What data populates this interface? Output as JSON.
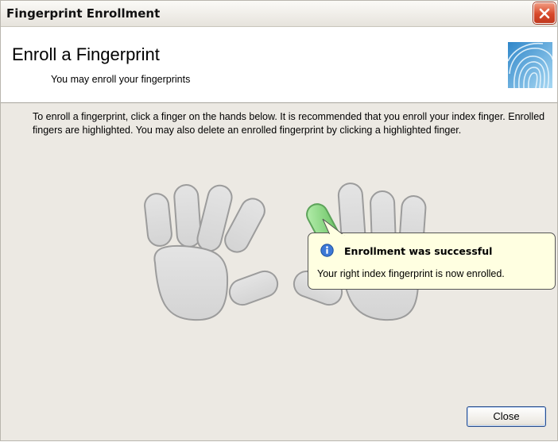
{
  "window": {
    "title": "Fingerprint Enrollment"
  },
  "header": {
    "title": "Enroll a Fingerprint",
    "subtitle": "You may enroll your fingerprints",
    "logo_icon": "fingerprint-icon"
  },
  "body": {
    "instructions": "To enroll a fingerprint, click a finger on the hands below. It is recommended that you enroll your index finger. Enrolled fingers are highlighted. You may also delete an enrolled fingerprint by clicking a highlighted finger."
  },
  "tooltip": {
    "icon": "info-icon",
    "title": "Enrollment was successful",
    "message": "Your right index fingerprint is now enrolled."
  },
  "hands": {
    "enrolled_finger": "right-index",
    "enrolled_color": "#7fd17a"
  },
  "buttons": {
    "close_label": "Close"
  }
}
